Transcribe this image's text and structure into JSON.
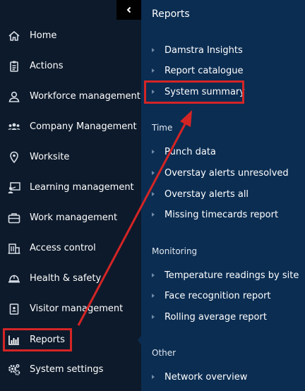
{
  "nav": {
    "items": [
      {
        "label": "Home",
        "icon": "home-icon"
      },
      {
        "label": "Actions",
        "icon": "clipboard-icon"
      },
      {
        "label": "Workforce management",
        "icon": "person-icon"
      },
      {
        "label": "Company Management",
        "icon": "group-icon"
      },
      {
        "label": "Worksite",
        "icon": "location-pin-icon"
      },
      {
        "label": "Learning management",
        "icon": "learning-icon"
      },
      {
        "label": "Work management",
        "icon": "briefcase-icon"
      },
      {
        "label": "Access control",
        "icon": "building-icon"
      },
      {
        "label": "Health & safety",
        "icon": "hardhat-icon"
      },
      {
        "label": "Visitor management",
        "icon": "id-badge-icon"
      },
      {
        "label": "Reports",
        "icon": "bar-chart-icon"
      },
      {
        "label": "System settings",
        "icon": "gears-icon"
      }
    ],
    "active": "Reports"
  },
  "flyout": {
    "title": "Reports",
    "general": [
      "Damstra Insights",
      "Report catalogue",
      "System summary"
    ],
    "time": {
      "title": "Time",
      "items": [
        "Punch data",
        "Overstay alerts unresolved",
        "Overstay alerts all",
        "Missing timecards report"
      ]
    },
    "monitoring": {
      "title": "Monitoring",
      "items": [
        "Temperature readings by site",
        "Face recognition report",
        "Rolling average report"
      ]
    },
    "other": {
      "title": "Other",
      "items": [
        "Network overview"
      ]
    }
  },
  "colors": {
    "sidebar_bg": "#0d1a2b",
    "flyout_bg": "#0b2d52",
    "highlight": "#d42525"
  }
}
